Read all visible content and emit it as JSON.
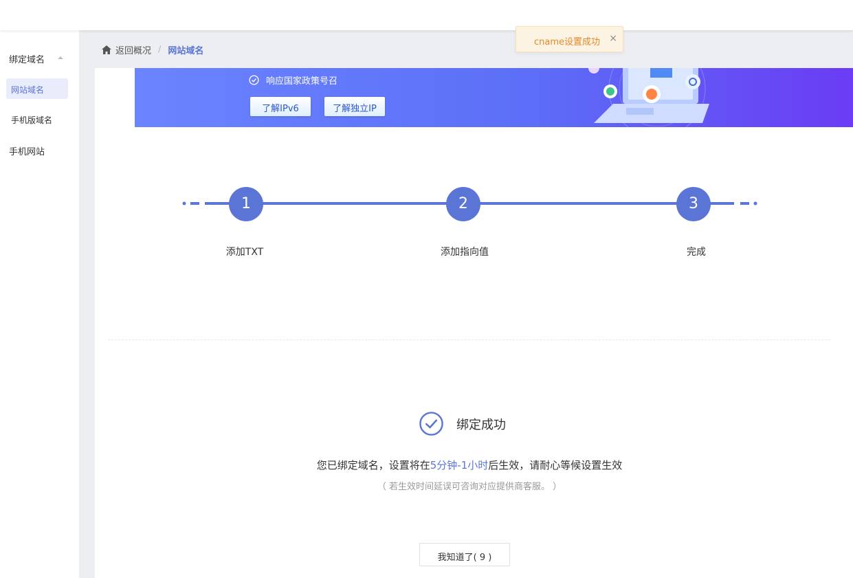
{
  "sidebar": {
    "group_label": "绑定域名",
    "items": [
      {
        "label": "网站域名"
      },
      {
        "label": "手机版域名"
      },
      {
        "label": "手机网站"
      }
    ]
  },
  "breadcrumb": {
    "back_label": "返回概况",
    "separator": "/",
    "current": "网站域名"
  },
  "toast": {
    "message": "cname设置成功",
    "close": "×"
  },
  "banner": {
    "slogan": "响应国家政策号召",
    "btn_ipv6": "了解IPv6",
    "btn_ip": "了解独立IP"
  },
  "steps": [
    {
      "number": "1",
      "label": "添加TXT"
    },
    {
      "number": "2",
      "label": "添加指向值"
    },
    {
      "number": "3",
      "label": "完成"
    }
  ],
  "result": {
    "title": "绑定成功",
    "text_before": "您已绑定域名，设置将在",
    "text_highlight": "5分钟-1小时",
    "text_after": "后生效，请耐心等候设置生效",
    "note": "（ 若生效时间延误可咨询对应提供商客服。 ）",
    "ok_button": "我知道了( 9 )"
  },
  "colors": {
    "accent": "#5b75d6",
    "toast_text": "#e08a2d",
    "toast_bg": "#fdf3e2"
  }
}
